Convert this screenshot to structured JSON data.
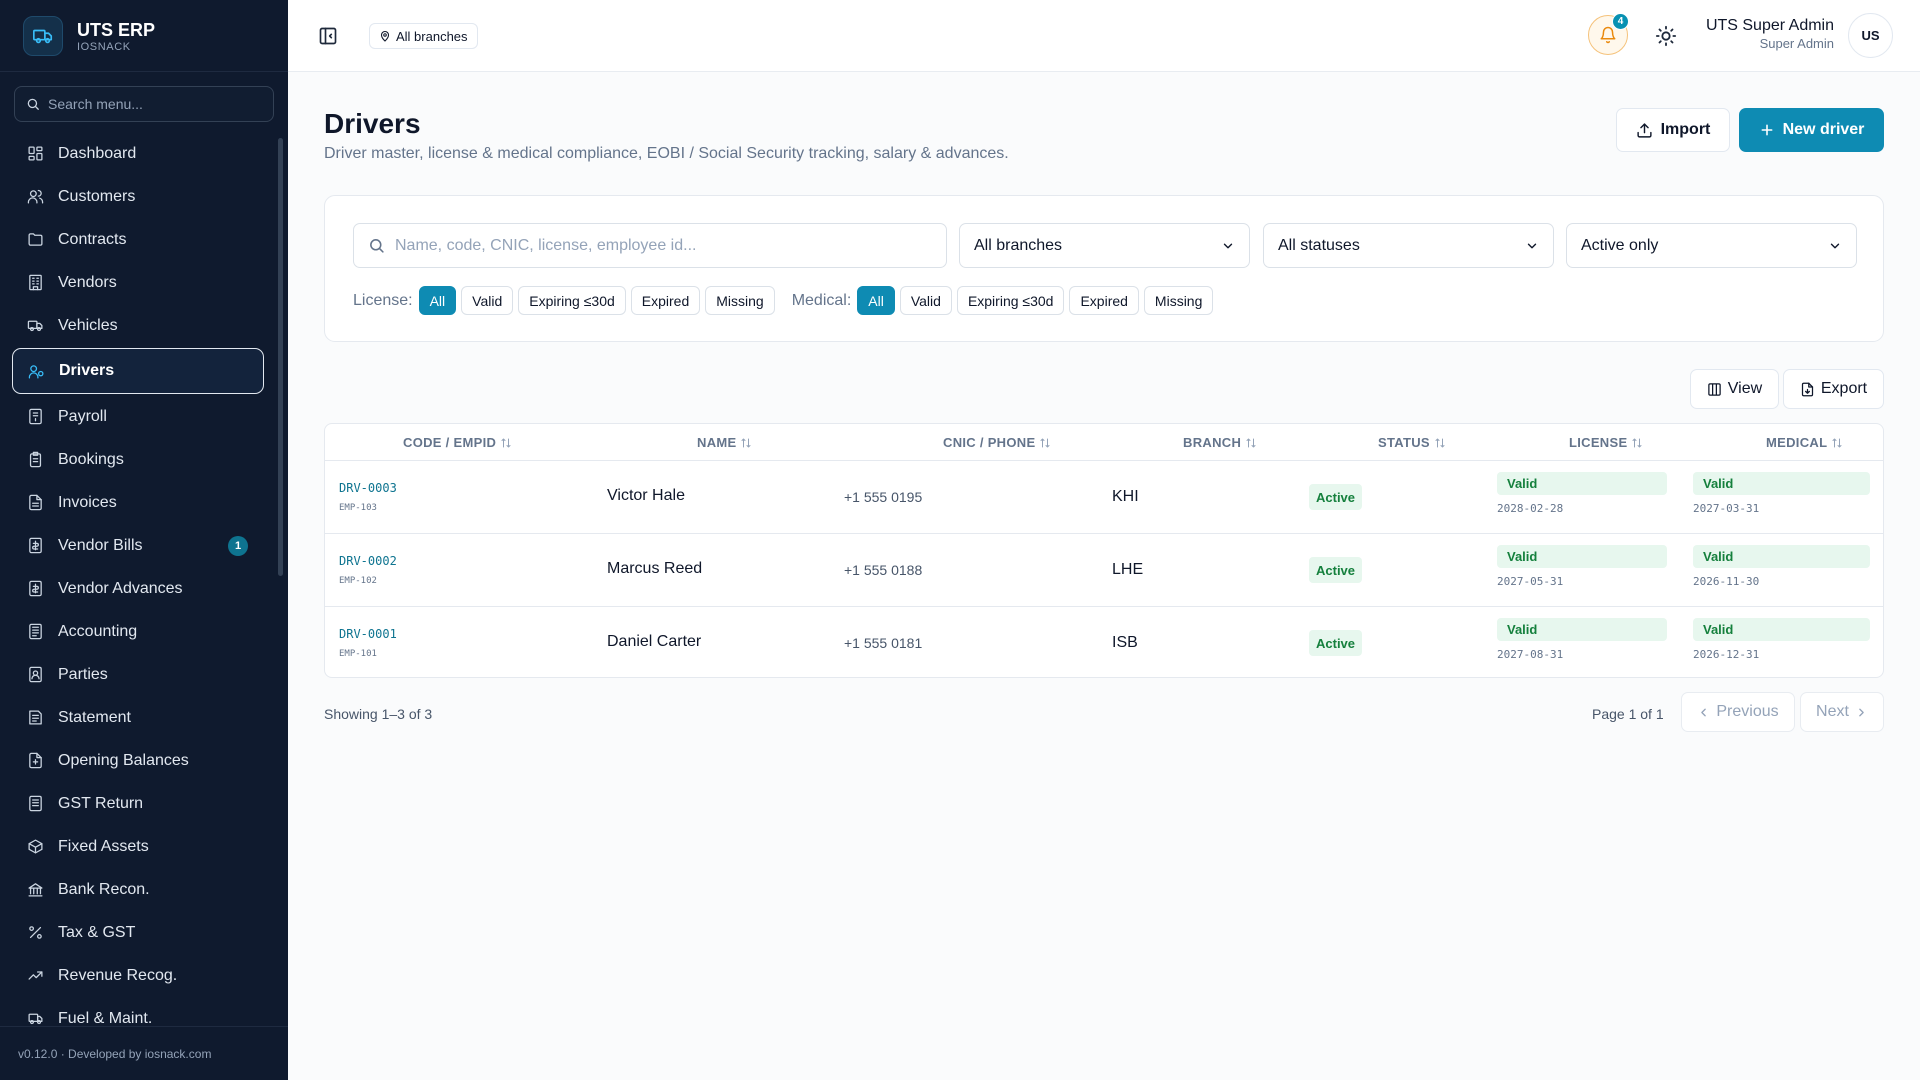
{
  "app": {
    "name": "UTS ERP",
    "company": "IOSNACK"
  },
  "sidebar": {
    "search_placeholder": "Search menu...",
    "items": [
      {
        "label": "Dashboard",
        "icon": "dashboard-icon"
      },
      {
        "label": "Customers",
        "icon": "users-icon"
      },
      {
        "label": "Contracts",
        "icon": "folder-icon"
      },
      {
        "label": "Vendors",
        "icon": "building-icon"
      },
      {
        "label": "Vehicles",
        "icon": "truck-icon"
      },
      {
        "label": "Drivers",
        "icon": "driver-icon",
        "active": true
      },
      {
        "label": "Payroll",
        "icon": "payroll-icon"
      },
      {
        "label": "Bookings",
        "icon": "clipboard-icon"
      },
      {
        "label": "Invoices",
        "icon": "document-icon"
      },
      {
        "label": "Vendor Bills",
        "icon": "bill-icon",
        "badge": "1"
      },
      {
        "label": "Vendor Advances",
        "icon": "advance-icon"
      },
      {
        "label": "Accounting",
        "icon": "ledger-icon"
      },
      {
        "label": "Parties",
        "icon": "contact-icon"
      },
      {
        "label": "Statement",
        "icon": "statement-icon"
      },
      {
        "label": "Opening Balances",
        "icon": "balance-icon"
      },
      {
        "label": "GST Return",
        "icon": "receipt-icon"
      },
      {
        "label": "Fixed Assets",
        "icon": "box-icon"
      },
      {
        "label": "Bank Recon.",
        "icon": "bank-icon"
      },
      {
        "label": "Tax & GST",
        "icon": "percent-icon"
      },
      {
        "label": "Revenue Recog.",
        "icon": "trend-icon"
      },
      {
        "label": "Fuel & Maint.",
        "icon": "fuel-icon"
      }
    ],
    "footer": "v0.12.0 · Developed by iosnack.com"
  },
  "header": {
    "branch_label": "All branches",
    "notification_count": "4",
    "user_name": "UTS Super Admin",
    "user_role": "Super Admin",
    "avatar_initials": "US"
  },
  "page": {
    "title": "Drivers",
    "subtitle": "Driver master, license & medical compliance, EOBI / Social Security tracking, salary & advances.",
    "import_label": "Import",
    "new_label": "New driver"
  },
  "filters": {
    "search_placeholder": "Name, code, CNIC, license, employee id...",
    "branch_value": "All branches",
    "status_value": "All statuses",
    "active_value": "Active only",
    "license_label": "License:",
    "medical_label": "Medical:",
    "license_chips": [
      "All",
      "Valid",
      "Expiring ≤30d",
      "Expired",
      "Missing"
    ],
    "medical_chips": [
      "All",
      "Valid",
      "Expiring ≤30d",
      "Expired",
      "Missing"
    ]
  },
  "toolbar": {
    "view_label": "View",
    "export_label": "Export"
  },
  "table": {
    "columns": [
      "CODE / EMPID",
      "NAME",
      "CNIC / PHONE",
      "BRANCH",
      "STATUS",
      "LICENSE",
      "MEDICAL"
    ],
    "rows": [
      {
        "code": "DRV-0003",
        "empid": "EMP-103",
        "name": "Victor Hale",
        "phone": "+1 555 0195",
        "branch": "KHI",
        "status": "Active",
        "license": "Valid",
        "license_date": "2028-02-28",
        "medical": "Valid",
        "medical_date": "2027-03-31"
      },
      {
        "code": "DRV-0002",
        "empid": "EMP-102",
        "name": "Marcus Reed",
        "phone": "+1 555 0188",
        "branch": "LHE",
        "status": "Active",
        "license": "Valid",
        "license_date": "2027-05-31",
        "medical": "Valid",
        "medical_date": "2026-11-30"
      },
      {
        "code": "DRV-0001",
        "empid": "EMP-101",
        "name": "Daniel Carter",
        "phone": "+1 555 0181",
        "branch": "ISB",
        "status": "Active",
        "license": "Valid",
        "license_date": "2027-08-31",
        "medical": "Valid",
        "medical_date": "2026-12-31"
      }
    ]
  },
  "pagination": {
    "showing": "Showing 1–3 of 3",
    "page": "Page 1 of 1",
    "previous": "Previous",
    "next": "Next"
  }
}
